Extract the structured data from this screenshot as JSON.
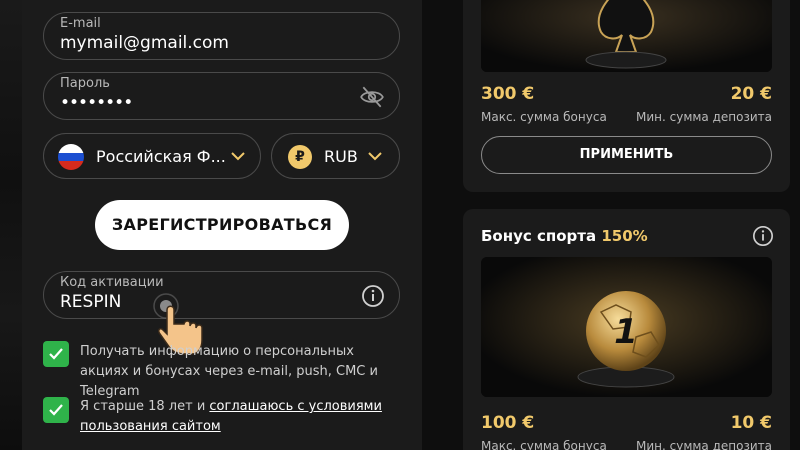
{
  "form": {
    "email": {
      "label": "E-mail",
      "value": "mymail@gmail.com"
    },
    "password": {
      "label": "Пароль",
      "value": "••••••••"
    },
    "country": {
      "value": "Российская Ф..."
    },
    "currency": {
      "symbol": "₽",
      "value": "RUB"
    },
    "register_label": "ЗАРЕГИСТРИРОВАТЬСЯ",
    "activation": {
      "label": "Код активации",
      "value": "RESPIN"
    },
    "consent_promo": "Получать информацию о персональных акциях и бонусах через e-mail, push, СМС и Telegram",
    "consent_age_prefix": "Я старше 18 лет и ",
    "consent_age_link": "соглашаюсь с условиями пользования сайтом"
  },
  "bonus_top": {
    "max_bonus": "300 €",
    "max_bonus_label": "Макс. сумма бонуса",
    "min_deposit": "20 €",
    "min_deposit_label": "Мин. сумма депозита",
    "apply_label": "ПРИМЕНИТЬ"
  },
  "bonus_sport": {
    "title": "Бонус спорта ",
    "percent": "150%",
    "max_bonus": "100 €",
    "max_bonus_label": "Макс. сумма бонуса",
    "min_deposit": "10 €",
    "min_deposit_label": "Мин. сумма депозита"
  },
  "colors": {
    "accent_gold": "#f1c96b",
    "check_green": "#2fb34a",
    "panel": "#1b1b1b"
  },
  "icons": [
    "eye-off-icon",
    "chevron-down-icon",
    "info-icon",
    "check-icon",
    "pointer-hand-icon",
    "russia-flag-icon",
    "ruble-icon"
  ]
}
